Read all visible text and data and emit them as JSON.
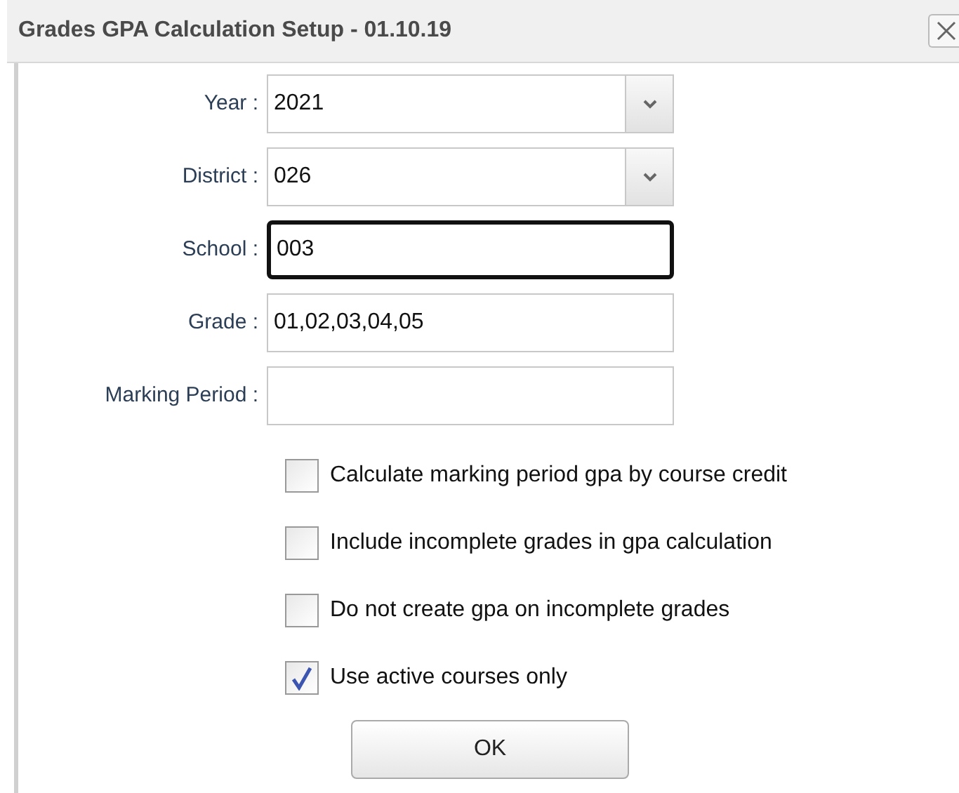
{
  "window": {
    "title": "Grades GPA Calculation Setup - 01.10.19"
  },
  "fields": [
    {
      "label": "Year :",
      "kind": "dropdown",
      "value": "2021",
      "focused": false
    },
    {
      "label": "District :",
      "kind": "dropdown",
      "value": "026",
      "focused": false
    },
    {
      "label": "School :",
      "kind": "text",
      "value": "003",
      "focused": true
    },
    {
      "label": "Grade :",
      "kind": "text",
      "value": "01,02,03,04,05",
      "focused": false
    },
    {
      "label": "Marking Period :",
      "kind": "text",
      "focused": false
    }
  ],
  "options": [
    {
      "label": "Calculate marking period gpa by course credit",
      "checked": false
    },
    {
      "label": "Include incomplete grades in gpa calculation",
      "checked": false
    },
    {
      "label": "Do not create gpa on incomplete grades",
      "checked": false
    },
    {
      "label": "Use active courses only",
      "checked": true
    }
  ],
  "buttons": [
    "OK"
  ]
}
